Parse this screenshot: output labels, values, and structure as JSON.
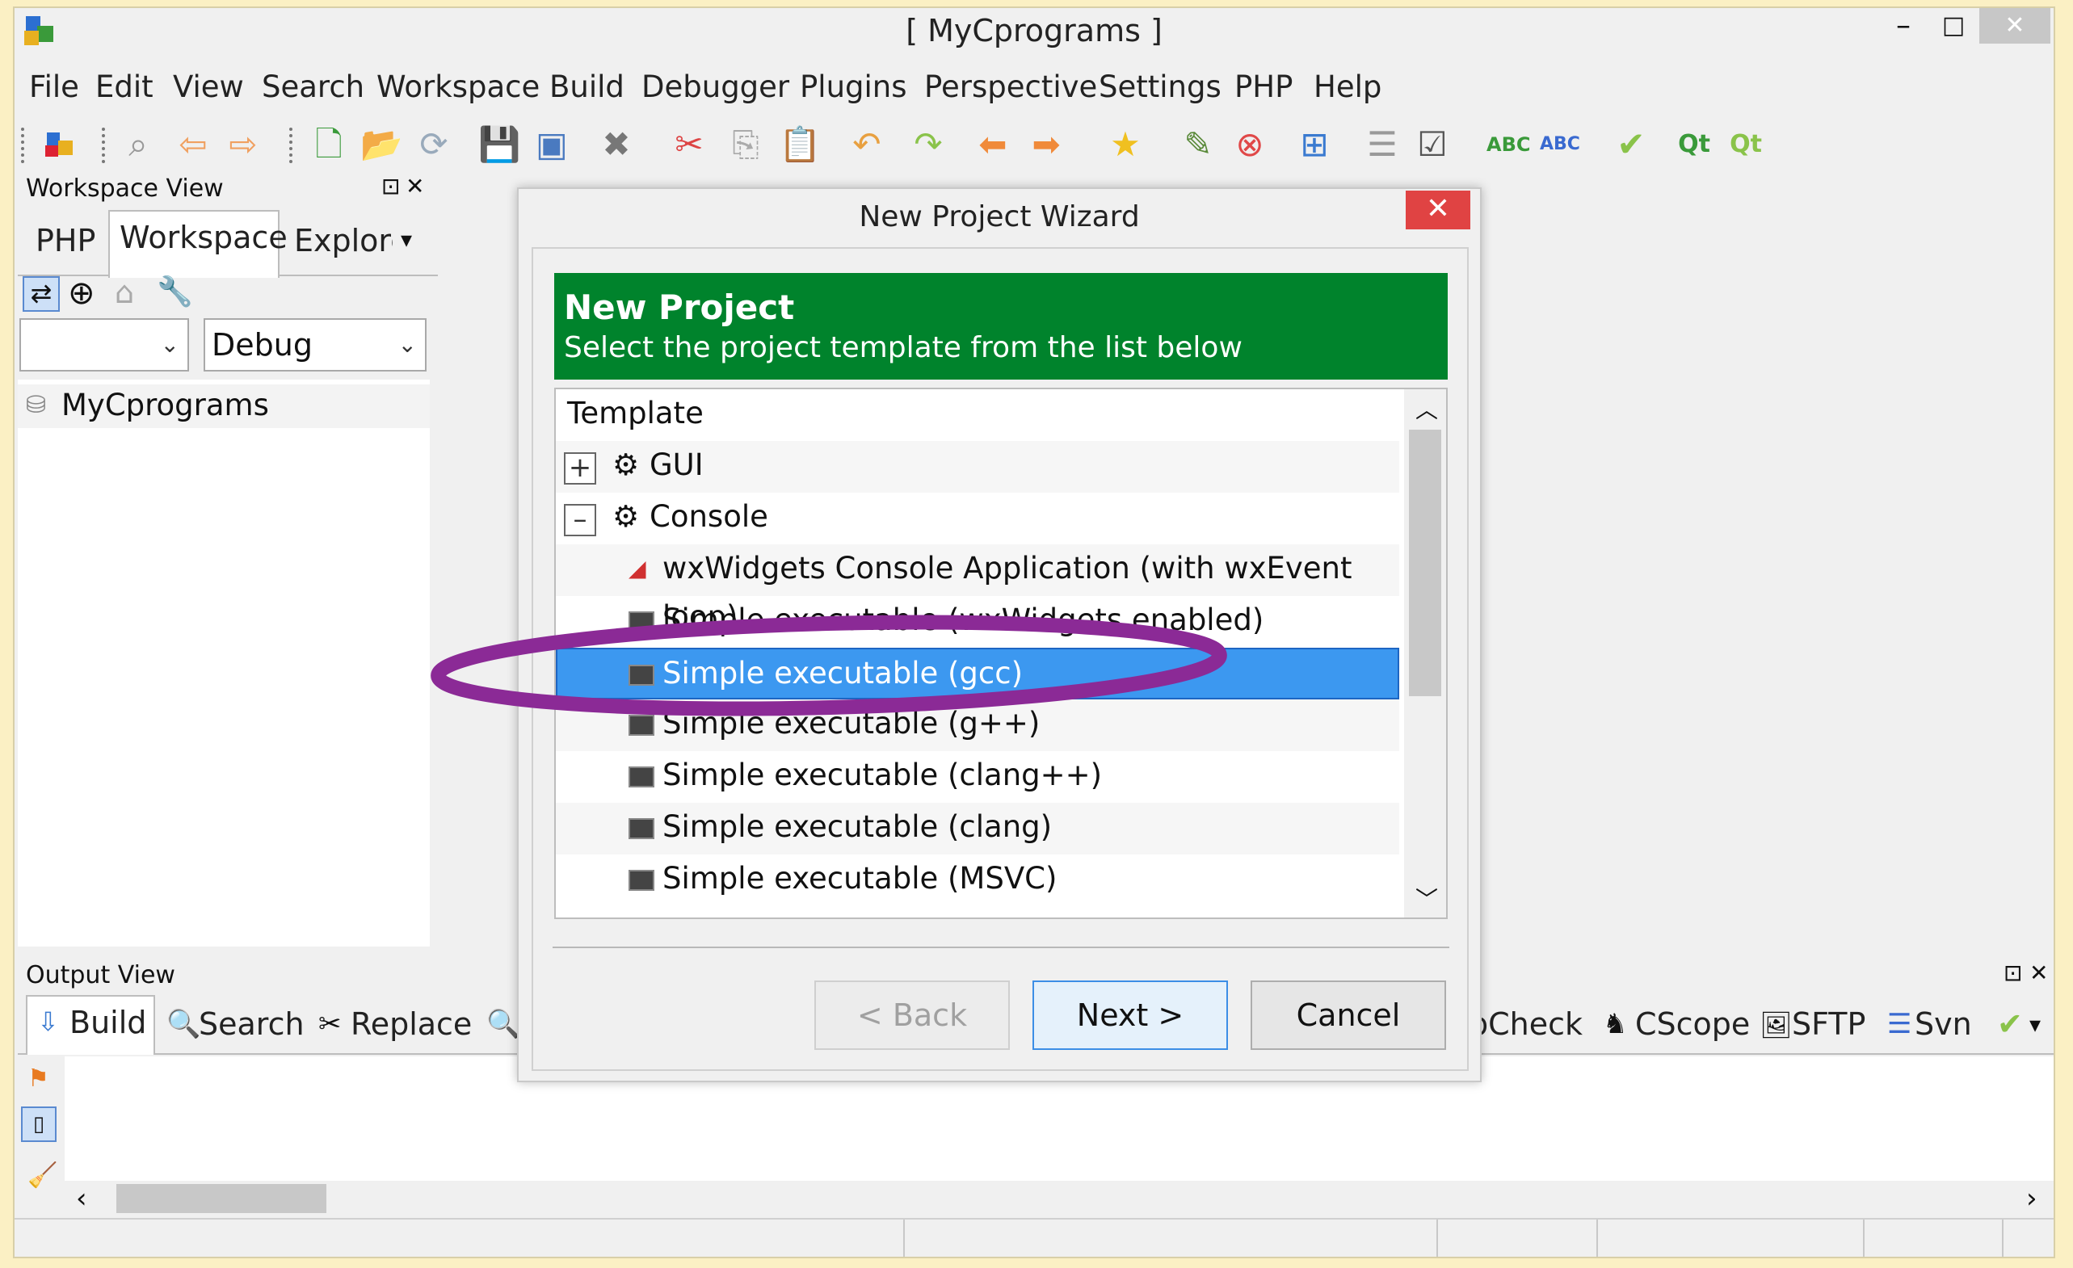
{
  "window": {
    "title": "[ MyCprograms ]",
    "min": "–",
    "max": "□",
    "close": "✕"
  },
  "menu": [
    "File",
    "Edit",
    "View",
    "Search",
    "Workspace",
    "Build",
    "Debugger",
    "Plugins",
    "Perspective",
    "Settings",
    "PHP",
    "Help"
  ],
  "workspace_view": {
    "title": "Workspace View",
    "pin": "⊡",
    "close": "✕",
    "tabs": [
      "PHP",
      "Workspace",
      "Explorer"
    ],
    "tab_more": "▾",
    "config_combo": "",
    "build_combo": "Debug",
    "tree_root": "MyCprograms"
  },
  "output_view": {
    "title": "Output View",
    "pin": "⊡",
    "close": "✕",
    "tabs": [
      "Build",
      "Search",
      "Replace"
    ],
    "right_tabs": [
      "pCheck",
      "CScope",
      "SFTP",
      "Svn"
    ]
  },
  "dialog": {
    "title": "New Project Wizard",
    "close": "✕",
    "header_title": "New Project",
    "header_subtitle": "Select the project template from the list below",
    "column": "Template",
    "categories": [
      {
        "label": "GUI",
        "expander": "+"
      },
      {
        "label": "Console",
        "expander": "–"
      }
    ],
    "items": [
      "wxWidgets Console Application (with wxEvent loop)",
      "Simple executable (wxWidgets enabled)",
      "Simple executable (gcc)",
      "Simple executable (g++)",
      "Simple executable (clang++)",
      "Simple executable (clang)",
      "Simple executable (MSVC)"
    ],
    "selected_item": "Simple executable (gcc)",
    "buttons": {
      "back": "< Back",
      "next": "Next >",
      "cancel": "Cancel"
    }
  },
  "colors": {
    "header": "#00832c",
    "selection": "#3c98f0",
    "annotation": "#8b2a96"
  }
}
